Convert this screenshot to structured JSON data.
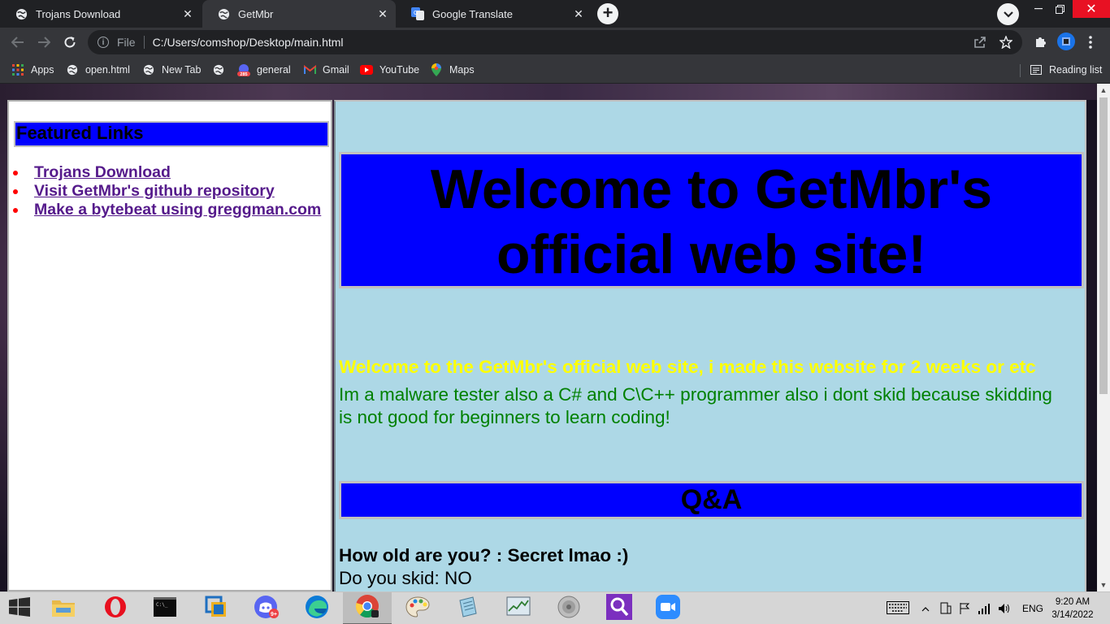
{
  "browser": {
    "tabs": [
      {
        "title": "Trojans Download",
        "active": false
      },
      {
        "title": "GetMbr",
        "active": true
      },
      {
        "title": "Google Translate",
        "active": false
      }
    ],
    "new_tab_symbol": "+",
    "address": {
      "scheme_label": "File",
      "url": "C:/Users/comshop/Desktop/main.html"
    },
    "bookmarks": [
      {
        "label": "Apps",
        "icon": "apps-grid-icon"
      },
      {
        "label": "open.html",
        "icon": "globe-icon"
      },
      {
        "label": "New Tab",
        "icon": "globe-icon"
      },
      {
        "label": "",
        "icon": "globe-icon"
      },
      {
        "label": "general",
        "icon": "discord-badge-icon",
        "badge": "285"
      },
      {
        "label": "Gmail",
        "icon": "gmail-icon"
      },
      {
        "label": "YouTube",
        "icon": "youtube-icon"
      },
      {
        "label": "Maps",
        "icon": "maps-icon"
      }
    ],
    "reading_list_label": "Reading list"
  },
  "page": {
    "sidebar": {
      "title": "Featured Links",
      "links": [
        "Trojans Download",
        "Visit GetMbr's github repository",
        "Make a bytebeat using greggman.com"
      ]
    },
    "main": {
      "banner_line1": "Welcome to GetMbr's",
      "banner_line2": "official web site!",
      "intro_yellow": "Welcome to the GetMbr's official web site, i made this website for 2 weeks or etc",
      "intro_green": "Im a malware tester also a C# and C\\C++ programmer also i dont skid because skidding is not good for beginners to learn coding!",
      "qa_title": "Q&A",
      "qa_question": "How old are you? : Secret lmao :)",
      "qa_answer": "Do you skid: NO"
    }
  },
  "taskbar": {
    "apps": [
      "file-explorer",
      "opera",
      "command-prompt",
      "virtualbox",
      "discord",
      "edge",
      "chrome",
      "paint",
      "notepad",
      "task-manager",
      "sound",
      "search-tool",
      "zoom"
    ],
    "discord_badge": "9+",
    "language": "ENG",
    "time": "9:20 AM",
    "date": "3/14/2022"
  },
  "colors": {
    "page_blue": "#0000ff",
    "main_bg": "#add8e6",
    "yellow_text": "#ffff00",
    "green_text": "#008000",
    "link_color": "#551a8b"
  }
}
